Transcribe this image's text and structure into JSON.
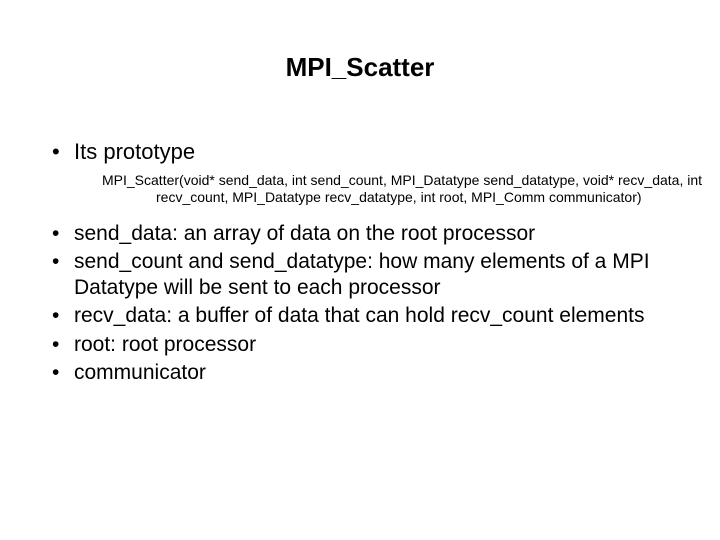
{
  "title": "MPI_Scatter",
  "bullets": {
    "prototype_label": "Its prototype",
    "prototype_sig": "MPI_Scatter(void* send_data, int send_count, MPI_Datatype send_datatype, void* recv_data, int recv_count, MPI_Datatype recv_datatype, int root, MPI_Comm communicator)",
    "items": [
      "send_data: an array of data on the root processor",
      "send_count and send_datatype: how many elements of a MPI Datatype will be sent to each processor",
      "recv_data: a buffer of data that can hold recv_count elements",
      "root: root processor",
      "communicator"
    ]
  }
}
